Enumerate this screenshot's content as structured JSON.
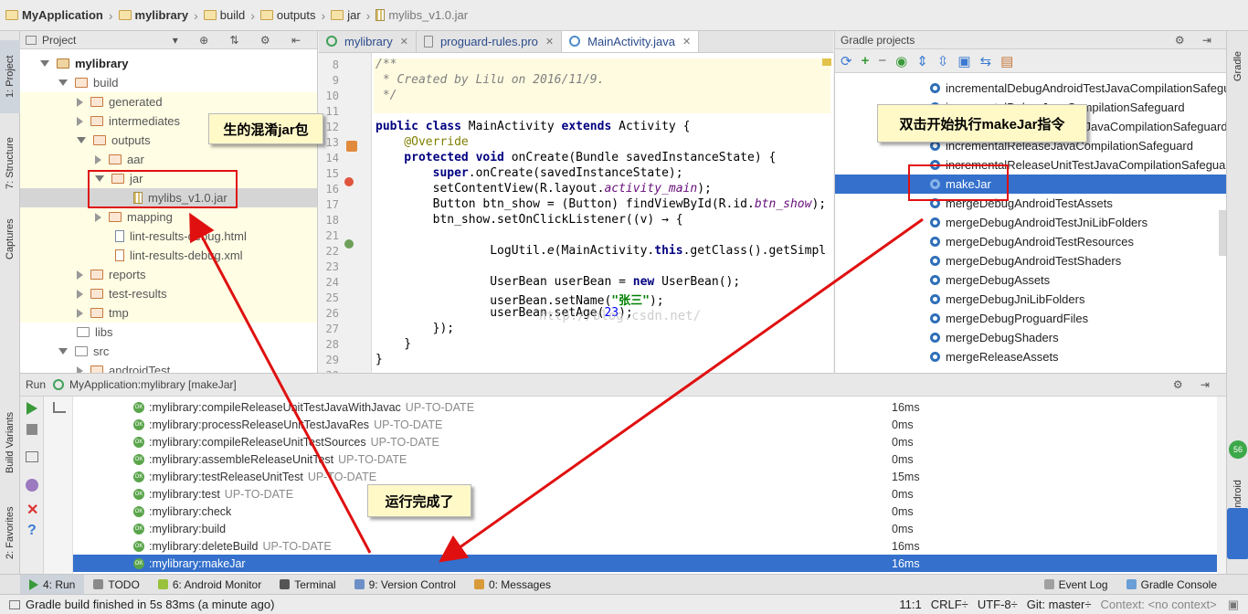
{
  "breadcrumb": [
    {
      "label": "MyApplication",
      "icon": "module-folder-icon"
    },
    {
      "label": "mylibrary",
      "icon": "module-folder-icon"
    },
    {
      "label": "build",
      "icon": "folder-icon"
    },
    {
      "label": "outputs",
      "icon": "folder-icon"
    },
    {
      "label": "jar",
      "icon": "folder-icon"
    },
    {
      "label": "mylibs_v1.0.jar",
      "icon": "jar-file-icon"
    }
  ],
  "left_strip": {
    "project": "1: Project",
    "structure": "7: Structure",
    "captures": "Captures",
    "build_variants": "Build Variants",
    "favorites": "2: Favorites"
  },
  "right_strip": {
    "gradle": "Gradle",
    "android": "Android"
  },
  "project_panel": {
    "title": "Project",
    "tree": [
      {
        "label": "mylibrary",
        "bold": true
      },
      {
        "label": "build"
      },
      {
        "label": "generated"
      },
      {
        "label": "intermediates"
      },
      {
        "label": "outputs"
      },
      {
        "label": "aar"
      },
      {
        "label": "jar"
      },
      {
        "label": "mylibs_v1.0.jar"
      },
      {
        "label": "mapping"
      },
      {
        "label": "lint-results-debug.html"
      },
      {
        "label": "lint-results-debug.xml"
      },
      {
        "label": "reports"
      },
      {
        "label": "test-results"
      },
      {
        "label": "tmp"
      },
      {
        "label": "libs"
      },
      {
        "label": "src"
      },
      {
        "label": "androidTest"
      }
    ]
  },
  "editor": {
    "tabs": [
      {
        "label": "mylibrary",
        "active": false
      },
      {
        "label": "proguard-rules.pro",
        "active": false
      },
      {
        "label": "MainActivity.java",
        "active": true
      }
    ],
    "line_numbers": [
      "8",
      "9",
      "10",
      "11",
      "12",
      "13",
      "14",
      "15",
      "16",
      "17",
      "18",
      "21",
      "22",
      "23",
      "24",
      "25",
      "26",
      "27",
      "28",
      "29",
      "30"
    ],
    "code": {
      "l8": "/**",
      "l9": " * Created by Lilu on 2016/11/9.",
      "l10": " */",
      "l12a": "public class ",
      "l12b": "MainActivity ",
      "l12c": "extends ",
      "l12d": "Activity {",
      "l13": "    @Override",
      "l14a": "    protected void ",
      "l14b": "onCreate(Bundle savedInstanceState) {",
      "l15a": "        super",
      "l15b": ".onCreate(savedInstanceState);",
      "l16a": "        setContentView(R.layout.",
      "l16b": "activity_main",
      "l16c": ");",
      "l17a": "        Button btn_show = (Button) findViewById(R.id.",
      "l17b": "btn_show",
      "l17c": ");",
      "l18": "        btn_show.setOnClickListener((v) → {",
      "l22a": "                LogUtil.",
      "l22b": "e",
      "l22c": "(MainActivity.",
      "l22d": "this",
      "l22e": ".getClass().getSimpl",
      "l24a": "                UserBean userBean = ",
      "l24b": "new ",
      "l24c": "UserBean();",
      "l25a": "                userBean.setName(",
      "l25b": "\"张三\"",
      "l25c": ");",
      "l26a": "                userBean.setAge(",
      "l26b": "23",
      "l26c": ");",
      "l27": "        });",
      "l28": "    }",
      "l29": "}"
    },
    "watermark": "http://blog.csdn.net/"
  },
  "gradle_panel": {
    "title": "Gradle projects",
    "tasks": [
      "incrementalDebugAndroidTestJavaCompilationSafeguard",
      "incrementalDebugJavaCompilationSafeguard",
      "incrementalDebugUnitTestJavaCompilationSafeguard",
      "incrementalReleaseJavaCompilationSafeguard",
      "incrementalReleaseUnitTestJavaCompilationSafeguard",
      "makeJar",
      "mergeDebugAndroidTestAssets",
      "mergeDebugAndroidTestJniLibFolders",
      "mergeDebugAndroidTestResources",
      "mergeDebugAndroidTestShaders",
      "mergeDebugAssets",
      "mergeDebugJniLibFolders",
      "mergeDebugProguardFiles",
      "mergeDebugShaders",
      "mergeReleaseAssets"
    ],
    "selected": "makeJar"
  },
  "run_panel": {
    "label": "Run",
    "config": "MyApplication:mylibrary [makeJar]",
    "rows": [
      {
        "task": ":mylibrary:compileReleaseUnitTestJavaWithJavac",
        "status": "UP-TO-DATE",
        "time": "16ms"
      },
      {
        "task": ":mylibrary:processReleaseUnitTestJavaRes",
        "status": "UP-TO-DATE",
        "time": "0ms"
      },
      {
        "task": ":mylibrary:compileReleaseUnitTestSources",
        "status": "UP-TO-DATE",
        "time": "0ms"
      },
      {
        "task": ":mylibrary:assembleReleaseUnitTest",
        "status": "UP-TO-DATE",
        "time": "0ms"
      },
      {
        "task": ":mylibrary:testReleaseUnitTest",
        "status": "UP-TO-DATE",
        "time": "15ms"
      },
      {
        "task": ":mylibrary:test",
        "status": "UP-TO-DATE",
        "time": "0ms"
      },
      {
        "task": ":mylibrary:check",
        "status": "",
        "time": "0ms"
      },
      {
        "task": ":mylibrary:build",
        "status": "",
        "time": "0ms"
      },
      {
        "task": ":mylibrary:deleteBuild",
        "status": "UP-TO-DATE",
        "time": "16ms"
      },
      {
        "task": ":mylibrary:makeJar",
        "status": "",
        "time": "16ms"
      }
    ],
    "ok_badge": "OK"
  },
  "tool_tabs": [
    {
      "label": "4: Run",
      "active": true
    },
    {
      "label": "TODO",
      "active": false
    },
    {
      "label": "6: Android Monitor",
      "active": false
    },
    {
      "label": "Terminal",
      "active": false
    },
    {
      "label": "9: Version Control",
      "active": false
    },
    {
      "label": "0: Messages",
      "active": false
    }
  ],
  "tool_tabs_right": [
    "Event Log",
    "Gradle Console"
  ],
  "status_bar": {
    "message": "Gradle build finished in 5s 83ms (a minute ago)",
    "position": "11:1",
    "line_sep": "CRLF÷",
    "encoding": "UTF-8÷",
    "vcs": "Git: master÷",
    "context": "Context: <no context>"
  },
  "annotations": {
    "jar_callout": "生的混淆jar包",
    "makejar_callout": "双击开始执行makeJar指令",
    "done_callout": "运行完成了",
    "arrow_color": "#e01010",
    "callout_bg": "#fff9c8"
  },
  "colors": {
    "selection": "#3470cc",
    "highlight_row": "#fffde4",
    "ok_green": "#5aa54b"
  }
}
